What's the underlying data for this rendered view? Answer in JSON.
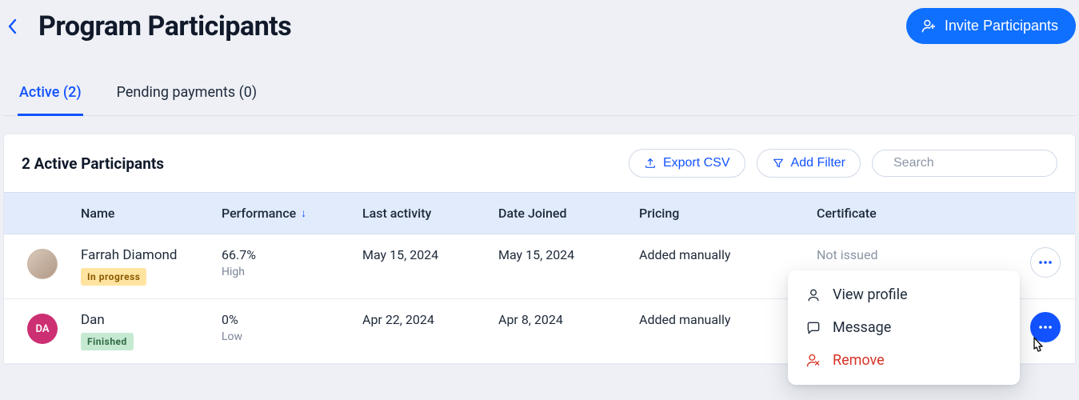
{
  "header": {
    "title": "Program Participants",
    "invite_label": "Invite Participants"
  },
  "tabs": {
    "active": {
      "label": "Active",
      "count": "(2)"
    },
    "pending": {
      "label": "Pending payments",
      "count": "(0)"
    }
  },
  "panel": {
    "title": "2 Active Participants",
    "export_label": "Export CSV",
    "filter_label": "Add Filter",
    "search_placeholder": "Search"
  },
  "columns": {
    "name": "Name",
    "performance": "Performance",
    "last_activity": "Last activity",
    "date_joined": "Date Joined",
    "pricing": "Pricing",
    "certificate": "Certificate"
  },
  "rows": [
    {
      "avatar_type": "image",
      "avatar_text": "",
      "name": "Farrah Diamond",
      "status_label": "In progress",
      "status_key": "inprog",
      "perf_value": "66.7%",
      "perf_level": "High",
      "last_activity": "May 15, 2024",
      "date_joined": "May 15, 2024",
      "pricing": "Added manually",
      "certificate": "Not issued",
      "menu_open": false
    },
    {
      "avatar_type": "initials",
      "avatar_text": "DA",
      "name": "Dan",
      "status_label": "Finished",
      "status_key": "finish",
      "perf_value": "0%",
      "perf_level": "Low",
      "last_activity": "Apr 22, 2024",
      "date_joined": "Apr 8, 2024",
      "pricing": "Added manually",
      "certificate": "",
      "menu_open": true
    }
  ],
  "dropdown": {
    "view_profile": "View profile",
    "message": "Message",
    "remove": "Remove"
  }
}
